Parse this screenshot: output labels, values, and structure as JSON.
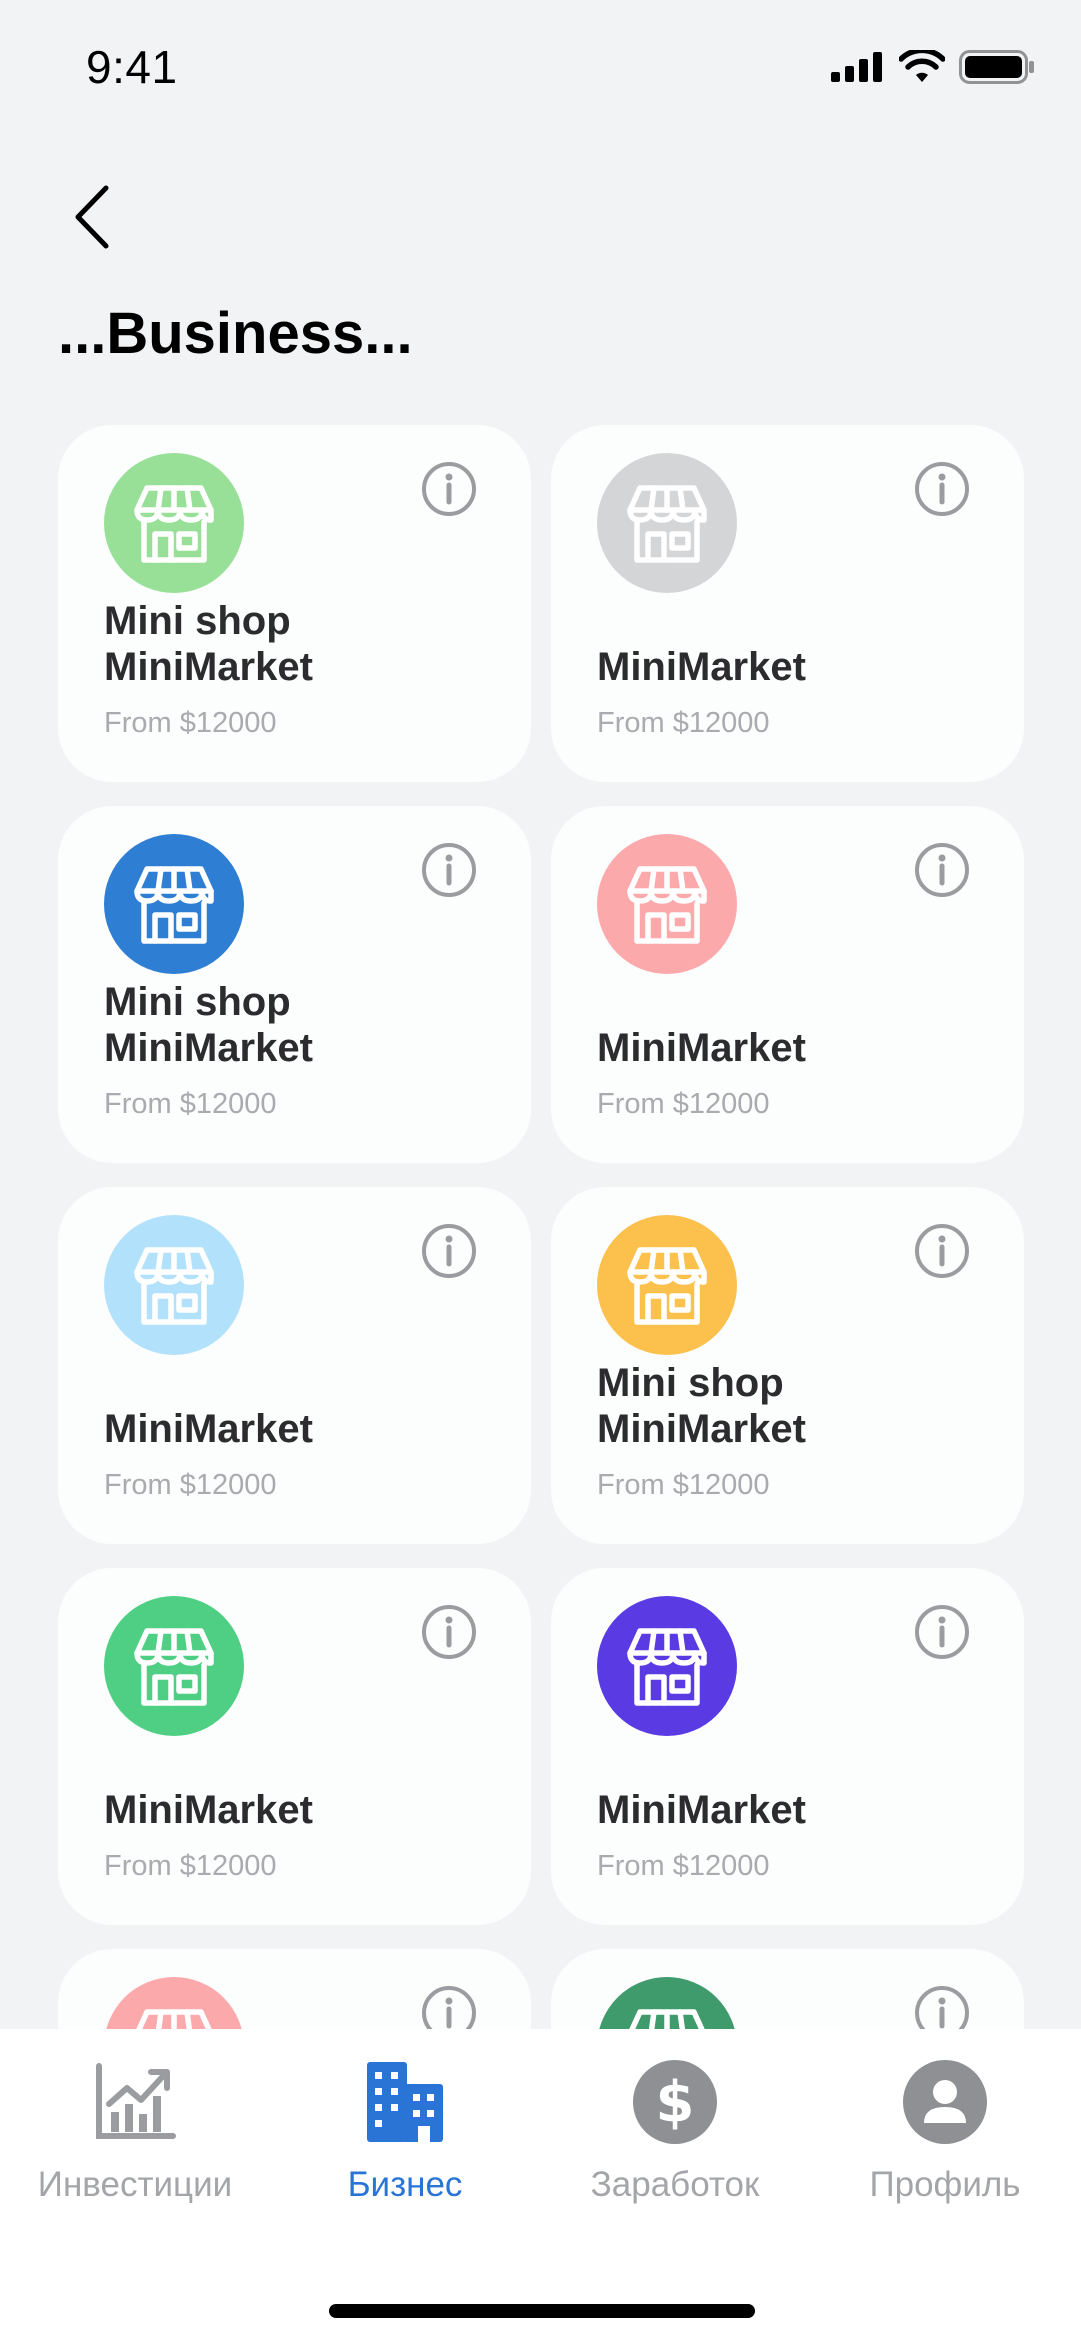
{
  "status_bar": {
    "time": "9:41"
  },
  "header": {
    "title": "...Business..."
  },
  "cards": [
    {
      "title": "Mini shop MiniMarket",
      "price": "From $12000",
      "icon": "shop-icon",
      "color": "#98e097"
    },
    {
      "title": "MiniMarket",
      "price": "From $12000",
      "icon": "shop-icon",
      "color": "#d4d5d7"
    },
    {
      "title": "Mini shop MiniMarket",
      "price": "From $12000",
      "icon": "shop-icon",
      "color": "#2e7ed3"
    },
    {
      "title": "MiniMarket",
      "price": "From $12000",
      "icon": "shop-icon",
      "color": "#fca9ab"
    },
    {
      "title": "MiniMarket",
      "price": "From $12000",
      "icon": "shop-icon",
      "color": "#b2e2fb"
    },
    {
      "title": "Mini shop MiniMarket",
      "price": "From $12000",
      "icon": "shop-icon",
      "color": "#fcc04d"
    },
    {
      "title": "MiniMarket",
      "price": "From $12000",
      "icon": "shop-icon",
      "color": "#4fcf84"
    },
    {
      "title": "MiniMarket",
      "price": "From $12000",
      "icon": "shop-icon",
      "color": "#5a3ae3"
    },
    {
      "title": "",
      "price": "",
      "icon": "shop-icon",
      "color": "#fca9ab"
    },
    {
      "title": "",
      "price": "",
      "icon": "shop-icon",
      "color": "#3f9a6c"
    }
  ],
  "tabs": [
    {
      "label": "Инвестиции",
      "icon": "chart-icon",
      "active": false
    },
    {
      "label": "Бизнес",
      "icon": "buildings-icon",
      "active": true
    },
    {
      "label": "Заработок",
      "icon": "dollar-icon",
      "active": false
    },
    {
      "label": "Профиль",
      "icon": "profile-icon",
      "active": false
    }
  ],
  "colors": {
    "accent": "#2a74d6",
    "inactive": "#a3a5a8",
    "background": "#f2f3f5"
  }
}
